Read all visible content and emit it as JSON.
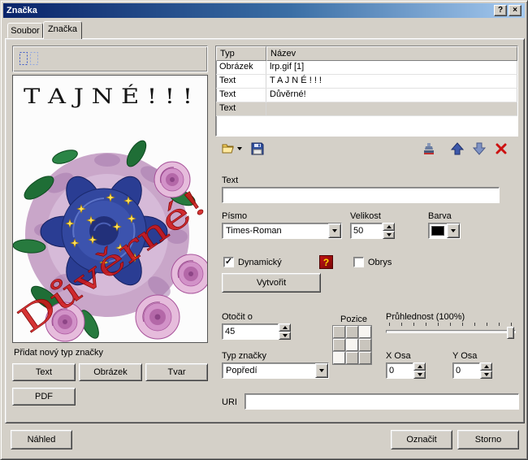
{
  "window": {
    "title": "Značka"
  },
  "titlebar": {
    "help": "?",
    "close": "×"
  },
  "tabs": [
    {
      "label": "Soubor"
    },
    {
      "label": "Značka"
    }
  ],
  "preview": {
    "title": "T A J N É ! ! !",
    "watermark": "Důvěrné!"
  },
  "left": {
    "add_label": "Přidat nový typ značky",
    "buttons": [
      {
        "label": "Text"
      },
      {
        "label": "Obrázek"
      },
      {
        "label": "Tvar"
      },
      {
        "label": "PDF"
      }
    ],
    "preview_button": "Náhled"
  },
  "table": {
    "columns": [
      {
        "label": "Typ"
      },
      {
        "label": "Název"
      }
    ],
    "rows": [
      {
        "typ": "Obrázek",
        "nazev": "lrp.gif [1]"
      },
      {
        "typ": "Text",
        "nazev": "T A J N É ! ! !"
      },
      {
        "typ": "Text",
        "nazev": "Důvěrné!"
      },
      {
        "typ": "Text",
        "nazev": ""
      }
    ]
  },
  "form": {
    "text_label": "Text",
    "text_value": "",
    "font_label": "Písmo",
    "font_value": "Times-Roman",
    "size_label": "Velikost",
    "size_value": "50",
    "color_label": "Barva",
    "color_value": "#000000",
    "dynamic_label": "Dynamický",
    "outline_label": "Obrys",
    "check_glyph": "✓",
    "help_glyph": "?",
    "create_button": "Vytvořit",
    "rotate_label": "Otočit o",
    "rotate_value": "45",
    "position_label": "Pozice",
    "transparency_label": "Průhlednost (100%)",
    "type_label": "Typ značky",
    "type_value": "Popředí",
    "x_label": "X Osa",
    "x_value": "0",
    "y_label": "Y Osa",
    "y_value": "0",
    "uri_label": "URI",
    "uri_value": ""
  },
  "footer": {
    "ok": "Označit",
    "cancel": "Storno"
  }
}
